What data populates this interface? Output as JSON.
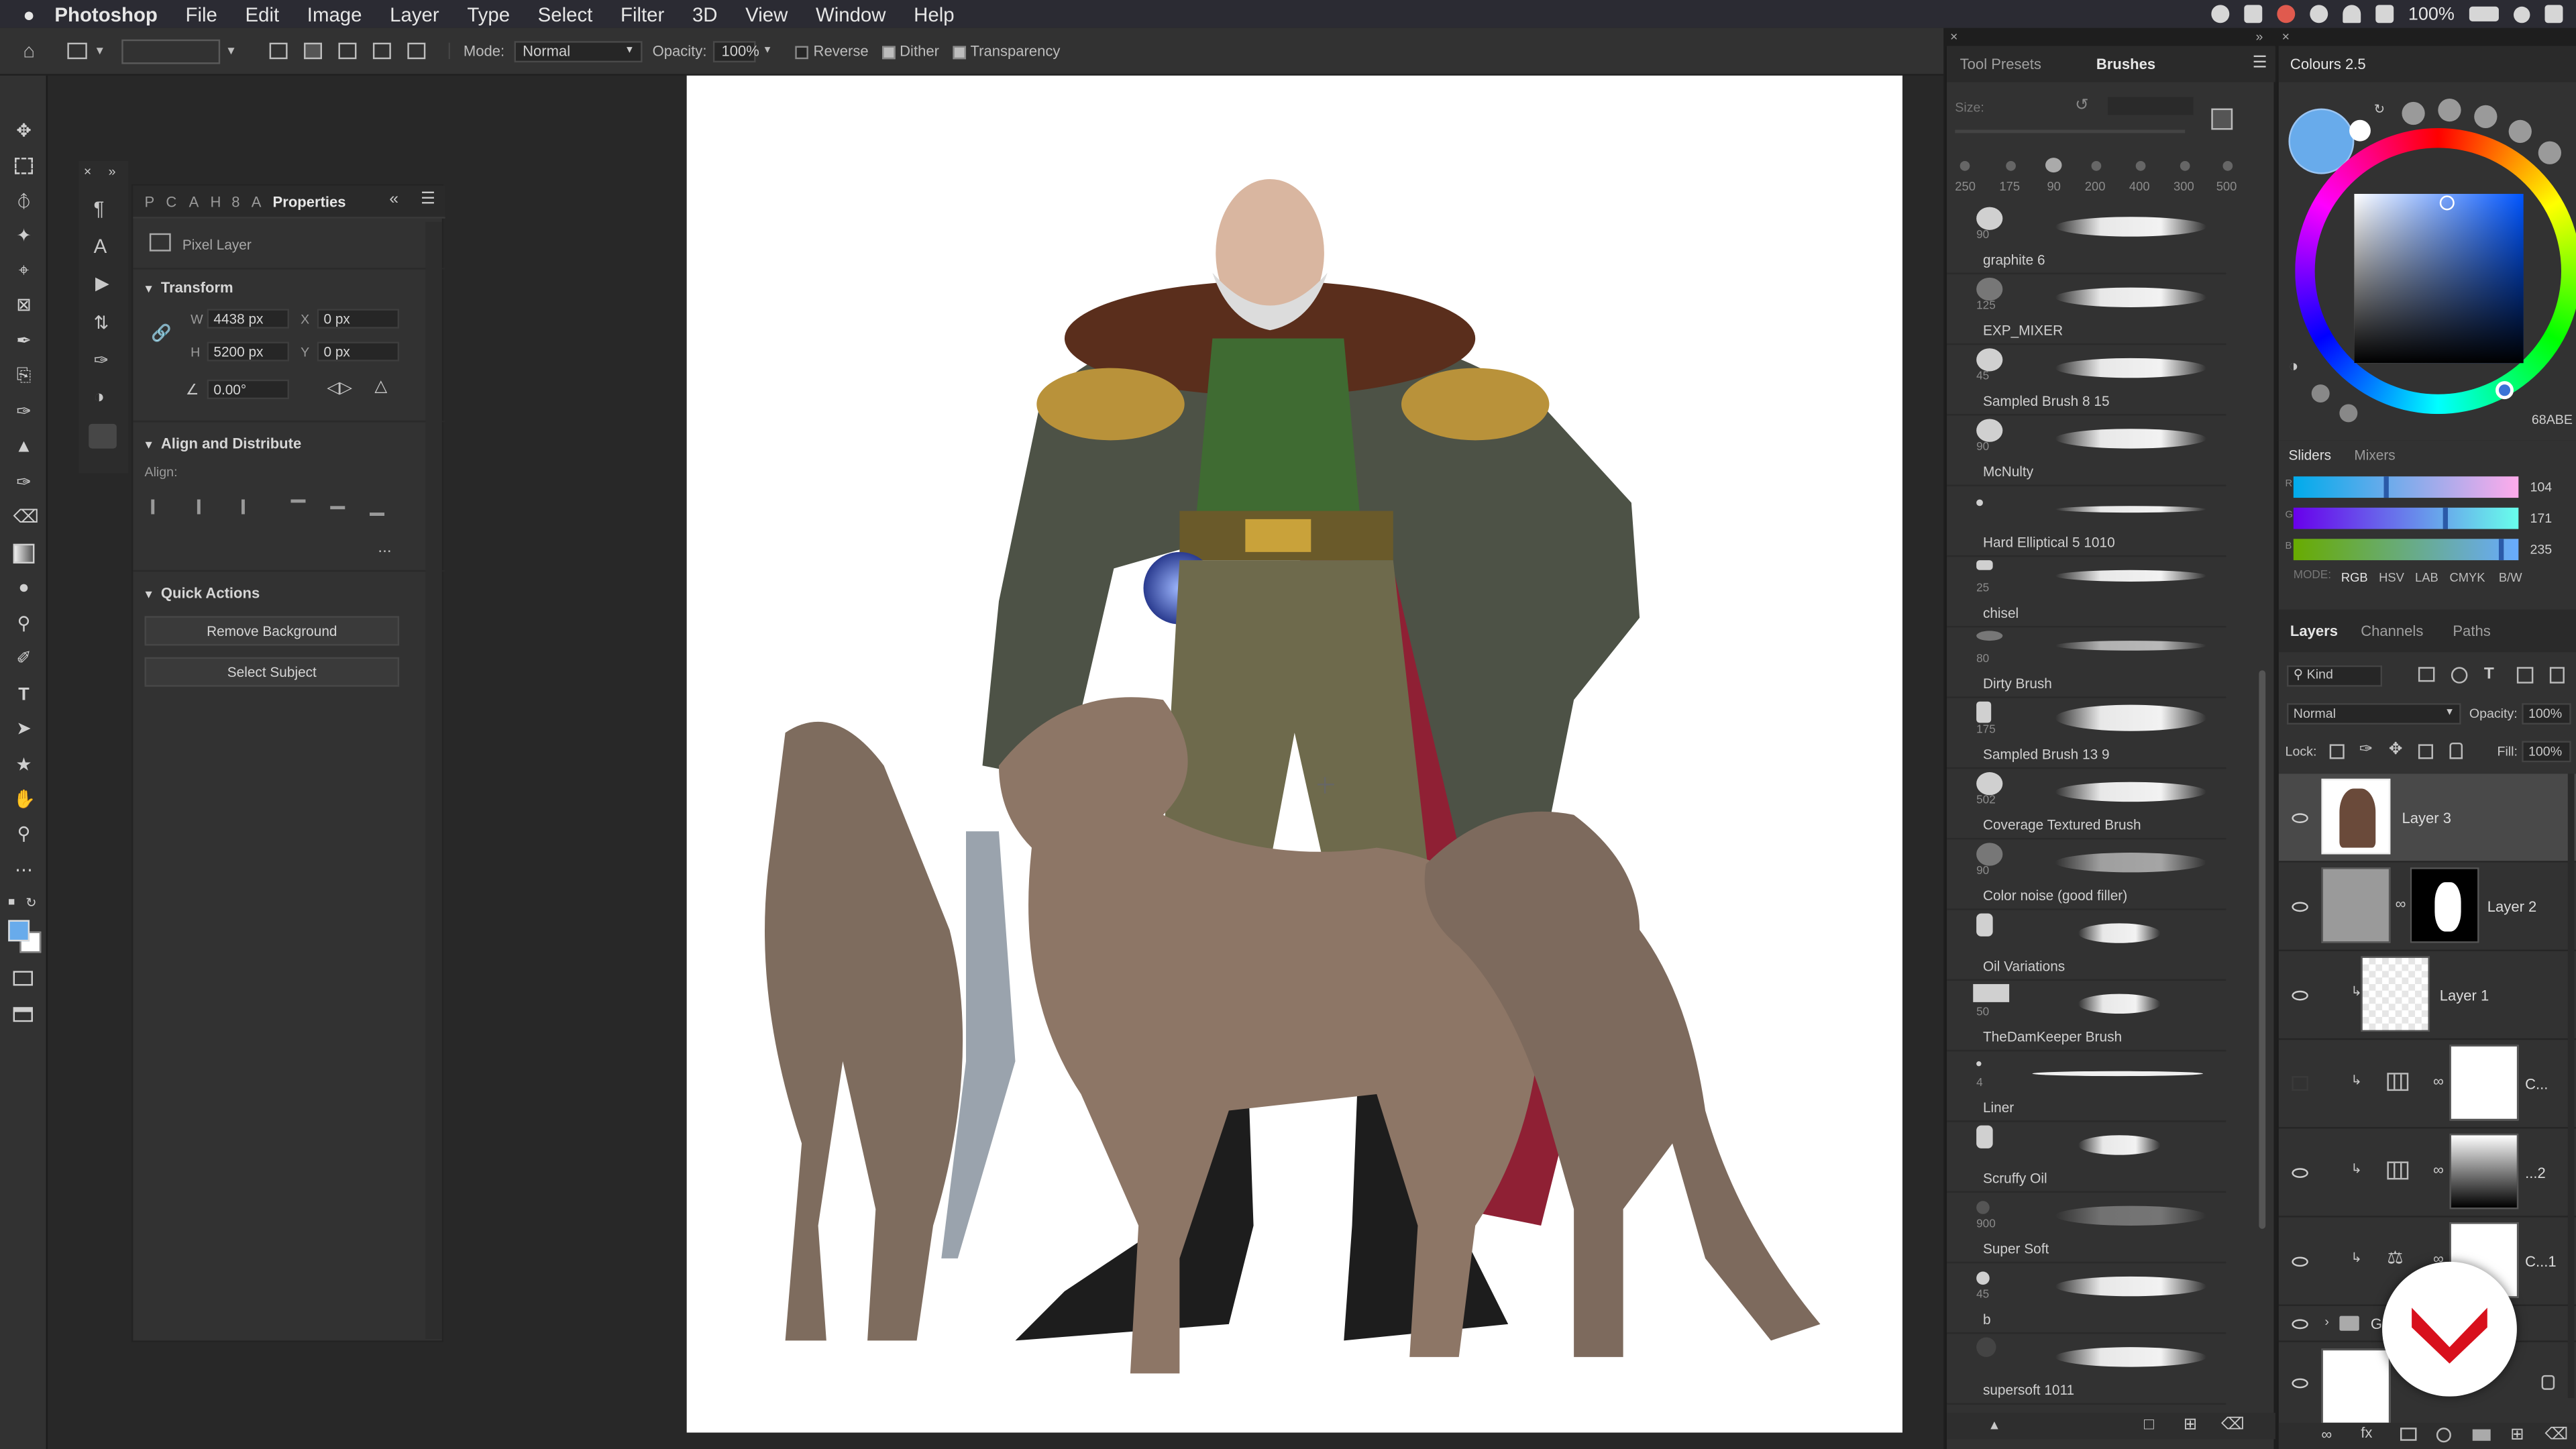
{
  "menubar": {
    "apple": "",
    "app": "Photoshop",
    "items": [
      "File",
      "Edit",
      "Image",
      "Layer",
      "Type",
      "Select",
      "Filter",
      "3D",
      "View",
      "Window",
      "Help"
    ],
    "battery": "100%"
  },
  "options": {
    "mode_label": "Mode:",
    "mode_value": "Normal",
    "opacity_label": "Opacity:",
    "opacity_value": "100%",
    "reverse": "Reverse",
    "dither": "Dither",
    "transparency": "Transparency"
  },
  "properties": {
    "tabs": [
      "P",
      "C",
      "A",
      "H",
      "8",
      "A"
    ],
    "active_tab": "Properties",
    "layer_type": "Pixel Layer",
    "transform_title": "Transform",
    "w_label": "W",
    "w_value": "4438 px",
    "h_label": "H",
    "h_value": "5200 px",
    "x_label": "X",
    "x_value": "0 px",
    "y_label": "Y",
    "y_value": "0 px",
    "angle_value": "0.00°",
    "align_title": "Align and Distribute",
    "align_label": "Align:",
    "more": "...",
    "quick_title": "Quick Actions",
    "remove_bg": "Remove Background",
    "select_subject": "Select Subject"
  },
  "brushes": {
    "tab_presets": "Tool Presets",
    "tab_brushes": "Brushes",
    "size_label": "Size:",
    "size_presets": [
      "250",
      "175",
      "90",
      "200",
      "400",
      "300",
      "500"
    ],
    "items": [
      {
        "size": "90",
        "name": "graphite 6"
      },
      {
        "size": "125",
        "name": "EXP_MIXER"
      },
      {
        "size": "45",
        "name": "Sampled Brush 8 15"
      },
      {
        "size": "90",
        "name": "McNulty"
      },
      {
        "size": "",
        "name": "Hard Elliptical 5 1010"
      },
      {
        "size": "25",
        "name": "chisel"
      },
      {
        "size": "80",
        "name": "Dirty Brush"
      },
      {
        "size": "175",
        "name": "Sampled Brush 13 9"
      },
      {
        "size": "502",
        "name": "Coverage Textured Brush"
      },
      {
        "size": "90",
        "name": "Color noise (good filler)"
      },
      {
        "size": "",
        "name": "Oil Variations"
      },
      {
        "size": "50",
        "name": "TheDamKeeper Brush"
      },
      {
        "size": "4",
        "name": "Liner"
      },
      {
        "size": "",
        "name": "Scruffy Oil"
      },
      {
        "size": "900",
        "name": "Super Soft"
      },
      {
        "size": "45",
        "name": "b"
      },
      {
        "size": "",
        "name": "supersoft 1011"
      }
    ]
  },
  "colours": {
    "title": "Colours 2.5",
    "hex": "68ABE",
    "accent": "#68abeb"
  },
  "sliders": {
    "tab_sliders": "Sliders",
    "tab_mixers": "Mixers",
    "r_label": "R",
    "r_value": "104",
    "g_label": "G",
    "g_value": "171",
    "b_label": "B",
    "b_value": "235",
    "mode_label": "MODE:",
    "modes": [
      "RGB",
      "HSV",
      "LAB",
      "CMYK",
      "B/W"
    ]
  },
  "layers": {
    "tabs": [
      "Layers",
      "Channels",
      "Paths"
    ],
    "kind": "Kind",
    "blend": "Normal",
    "opacity_label": "Opacity:",
    "opacity_value": "100%",
    "lock_label": "Lock:",
    "fill_label": "Fill:",
    "fill_value": "100%",
    "rows": [
      {
        "name": "Layer 3"
      },
      {
        "name": "Layer 2"
      },
      {
        "name": "Layer 1"
      },
      {
        "name": "C..."
      },
      {
        "name": "...2"
      },
      {
        "name": "C...1"
      },
      {
        "name": "G..."
      },
      {
        "name": ""
      }
    ]
  }
}
